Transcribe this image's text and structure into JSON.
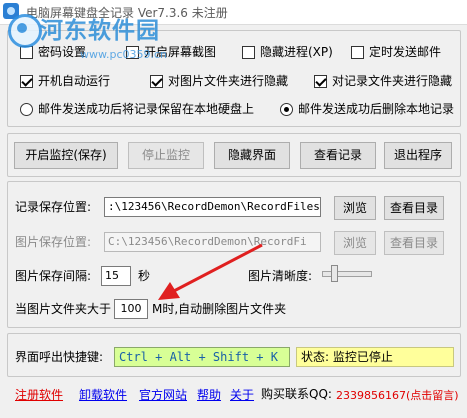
{
  "window": {
    "title": "电脑屏幕键盘全记录  Ver7.3.6  未注册"
  },
  "watermark": {
    "site_name": "河东软件园",
    "url": "www.pc0359.cn"
  },
  "options": {
    "row1": [
      {
        "label": "密码设置",
        "checked": false
      },
      {
        "label": "开启屏幕截图",
        "checked": false
      },
      {
        "label": "隐藏进程(XP)",
        "checked": false
      },
      {
        "label": "定时发送邮件",
        "checked": false
      }
    ],
    "row2": [
      {
        "label": "开机自动运行",
        "checked": true
      },
      {
        "label": "对图片文件夹进行隐藏",
        "checked": true
      },
      {
        "label": "对记录文件夹进行隐藏",
        "checked": true
      }
    ],
    "radios": [
      {
        "label": "邮件发送成功后将记录保留在本地硬盘上",
        "selected": false
      },
      {
        "label": "邮件发送成功后删除本地记录",
        "selected": true
      }
    ]
  },
  "controls": {
    "start_monitor": "开启监控(保存)",
    "stop_monitor": "停止监控",
    "hide_ui": "隐藏界面",
    "view_records": "查看记录",
    "exit": "退出程序"
  },
  "settings": {
    "record_path_label": "记录保存位置:",
    "record_path_value": ":\\123456\\RecordDemon\\RecordFiles",
    "browse_label": "浏览",
    "view_dir_label": "查看目录",
    "image_path_label": "图片保存位置:",
    "image_path_value": "C:\\123456\\RecordDemon\\RecordFi",
    "image_interval_label": "图片保存间隔:",
    "image_interval_value": "15",
    "seconds_unit": "秒",
    "clarity_label": "图片清晰度:",
    "clarity_level": 0.2,
    "autodelete_prefix": "当图片文件夹大于",
    "autodelete_value": "100",
    "autodelete_suffix": "M时,自动删除图片文件夹"
  },
  "hotkey": {
    "label": "界面呼出快捷键:",
    "value": "Ctrl + Alt + Shift + K",
    "status": "状态: 监控已停止"
  },
  "links": {
    "register": "注册软件",
    "uninstall": "卸载软件",
    "website": "官方网站",
    "help": "帮助",
    "about": "关于",
    "purchase_label": "购买联系QQ:",
    "qq": "2339856167(点击留言)"
  },
  "colors": {
    "accent_red": "#e00000",
    "link_blue": "#0000ee",
    "hotkey_bg": "#d8ff96",
    "status_bg": "#ffff9b",
    "annotation_arrow": "#e02020"
  }
}
